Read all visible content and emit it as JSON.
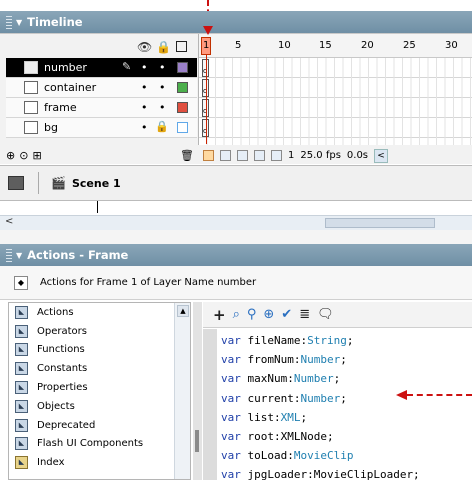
{
  "timeline": {
    "title": "Timeline",
    "ruler": [
      "1",
      "5",
      "10",
      "15",
      "20",
      "25",
      "30"
    ],
    "layers": [
      {
        "name": "number",
        "selected": true,
        "swatch": "#9a80c8"
      },
      {
        "name": "container",
        "selected": false,
        "swatch": "#4caf4c"
      },
      {
        "name": "frame",
        "selected": false,
        "swatch": "#e05040"
      },
      {
        "name": "bg",
        "selected": false,
        "swatch": "#60a8e8"
      }
    ],
    "current_frame": "1",
    "frame_rate": "25.0 fps",
    "elapsed": "0.0s"
  },
  "scene": {
    "label": "Scene 1"
  },
  "actions": {
    "title": "Actions - Frame",
    "header_text": "Actions for Frame 1 of Layer Name number",
    "toolbox": [
      "Actions",
      "Operators",
      "Functions",
      "Constants",
      "Properties",
      "Objects",
      "Deprecated",
      "Flash UI Components",
      "Index"
    ],
    "toolbar_icons": [
      "add-icon",
      "find-icon",
      "replace-icon",
      "target-icon",
      "check-syntax-icon",
      "auto-format-icon",
      "code-hint-icon"
    ],
    "code": [
      {
        "kw": "var",
        "name": " fileName:",
        "type": "String",
        "end": ";"
      },
      {
        "kw": "var",
        "name": " fromNum:",
        "type": "Number",
        "end": ";"
      },
      {
        "kw": "var",
        "name": " maxNum:",
        "type": "Number",
        "end": ";"
      },
      {
        "kw": "var",
        "name": " current:",
        "type": "Number",
        "end": ";"
      },
      {
        "kw": "var",
        "name": " list:",
        "type": "XML",
        "end": ";"
      },
      {
        "kw": "var",
        "name": " root:XMLNode;",
        "type": "",
        "end": ""
      },
      {
        "kw": "var",
        "name": " toLoad:",
        "type": "MovieClip",
        "end": ""
      },
      {
        "kw": "var",
        "name": " jpgLoader:MovieClipLoader;",
        "type": "",
        "end": ""
      }
    ]
  },
  "colors": {
    "panel_title": "#7a98ad",
    "callout": "#cc1111",
    "keyword": "#1f3fa8"
  }
}
